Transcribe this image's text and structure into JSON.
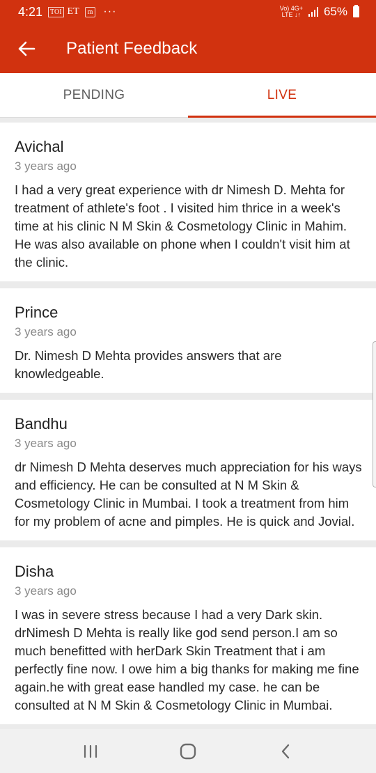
{
  "status_bar": {
    "time": "4:21",
    "notif_icons": [
      "TOI",
      "ET",
      "m"
    ],
    "more": "···",
    "network_top": "Vo) 4G+",
    "network_bottom": "LTE ↓↑",
    "battery": "65%"
  },
  "app_bar": {
    "title": "Patient Feedback",
    "back_icon": "arrow-back-icon"
  },
  "tabs": [
    {
      "label": "PENDING",
      "active": false
    },
    {
      "label": "LIVE",
      "active": true
    }
  ],
  "feedback": [
    {
      "name": "Avichal",
      "time": "3 years ago",
      "text": "I had a very great experience with dr Nimesh D. Mehta for treatment of athlete's foot . I visited him thrice in a week's time at his clinic N M Skin & Cosmetology Clinic in Mahim. He was also available on phone when I couldn't visit him at the clinic."
    },
    {
      "name": "Prince",
      "time": "3 years ago",
      "text": "Dr. Nimesh D Mehta provides answers that are knowledgeable."
    },
    {
      "name": "Bandhu",
      "time": "3 years ago",
      "text": "dr Nimesh D Mehta deserves much appreciation for his ways and efficiency. He can be consulted at N M Skin & Cosmetology Clinic in Mumbai. I took a treatment from him for my problem of acne and pimples. He is quick and Jovial."
    },
    {
      "name": "Disha",
      "time": "3 years ago",
      "text": "I was in severe stress because I had a very Dark skin. drNimesh D Mehta is really like god send person.I am so much benefitted with herDark Skin Treatment that i am perfectly fine now. I owe him a big thanks for making me fine again.he with great ease handled my case. he can be consulted at N M Skin & Cosmetology Clinic in Mumbai."
    }
  ],
  "nav_bar": {
    "icons": [
      "recent-apps-icon",
      "home-icon",
      "back-icon"
    ]
  },
  "colors": {
    "primary": "#d1320f",
    "background": "#ebebeb",
    "card": "#ffffff",
    "secondary_text": "#8a8a8a"
  }
}
